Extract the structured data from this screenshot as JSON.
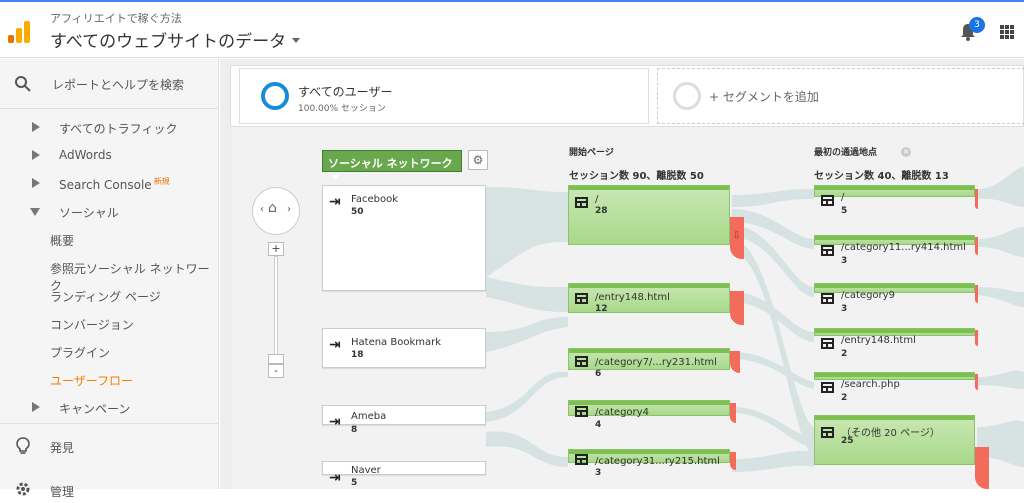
{
  "header": {
    "account": "アフィリエイトで稼ぐ方法",
    "property": "すべてのウェブサイトのデータ",
    "notifications": "3",
    "logo_colors": [
      "#f9ab00",
      "#e37400"
    ],
    "accent": "#4285f4"
  },
  "sidebar": {
    "search_label": "レポートとヘルプを検索",
    "items": [
      {
        "label": "すべてのトラフィック",
        "expanded": false
      },
      {
        "label": "AdWords",
        "expanded": false
      },
      {
        "label": "Search Console",
        "badge": "新規",
        "expanded": false
      },
      {
        "label": "ソーシャル",
        "expanded": true
      }
    ],
    "social_sub": [
      {
        "label": "概要"
      },
      {
        "label": "参照元ソーシャル ネットワーク"
      },
      {
        "label": "ランディング ページ"
      },
      {
        "label": "コンバージョン"
      },
      {
        "label": "プラグイン"
      },
      {
        "label": "ユーザーフロー",
        "active": true
      }
    ],
    "campaign": "キャンペーン",
    "discover": "発見",
    "admin": "管理"
  },
  "segments": {
    "all_users_label": "すべてのユーザー",
    "all_users_sub": "100.00% セッション",
    "add_segment": "+ セグメントを追加"
  },
  "flow": {
    "dimension_button": "ソーシャル ネットワーク",
    "sources": [
      {
        "name": "Facebook",
        "count": "50"
      },
      {
        "name": "Hatena Bookmark",
        "count": "18"
      },
      {
        "name": "Ameba",
        "count": "8"
      },
      {
        "name": "Naver",
        "count": "5"
      }
    ],
    "start_col": {
      "title": "開始ページ",
      "summary": "セッション数 90、離脱数 50",
      "pages": [
        {
          "name": "/",
          "count": "28"
        },
        {
          "name": "/entry148.html",
          "count": "12"
        },
        {
          "name": "/category7/...ry231.html",
          "count": "6"
        },
        {
          "name": "/category4",
          "count": "4"
        },
        {
          "name": "/category31...ry215.html",
          "count": "3"
        }
      ]
    },
    "first_col": {
      "title": "最初の通過地点",
      "summary": "セッション数 40、離脱数 13",
      "pages": [
        {
          "name": "/",
          "count": "5"
        },
        {
          "name": "/category11...ry414.html",
          "count": "3"
        },
        {
          "name": "/category9",
          "count": "3"
        },
        {
          "name": "/entry148.html",
          "count": "2"
        },
        {
          "name": "/search.php",
          "count": "2"
        },
        {
          "name": "（その他 20 ページ）",
          "count": "25"
        }
      ]
    },
    "colors": {
      "node": "#a8d98a",
      "drop": "#f26b5b",
      "flow": "#d6e3e3"
    }
  }
}
